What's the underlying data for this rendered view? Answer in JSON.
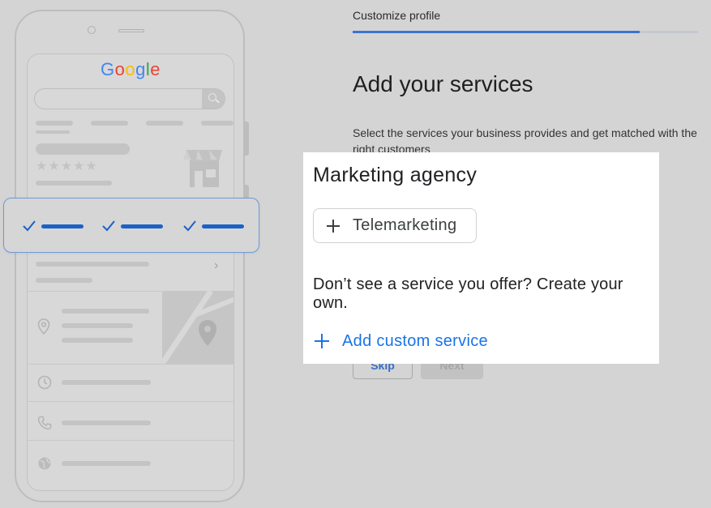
{
  "phone_mockup": {
    "logo": [
      "G",
      "o",
      "o",
      "g",
      "l",
      "e"
    ],
    "rating_stars": "★★★★★",
    "checked_services_count": 3
  },
  "header": {
    "step_title": "Customize profile",
    "progress_fraction": 0.83
  },
  "main": {
    "heading": "Add your services",
    "description": "Select the services your business provides and get matched with the right customers"
  },
  "panel": {
    "category": "Marketing agency",
    "suggested_services": [
      {
        "label": "Telemarketing",
        "icon": "plus-icon"
      }
    ],
    "prompt": "Don’t see a service you offer? Create your own.",
    "add_custom_label": "Add custom service"
  },
  "footer": {
    "skip_label": "Skip",
    "next_label": "Next"
  },
  "colors": {
    "background": "#d4d4d4",
    "accent_blue": "#1a73e8",
    "progress_blue": "#3b74d1",
    "check_blue": "#1a62c8",
    "panel_white": "#ffffff"
  }
}
